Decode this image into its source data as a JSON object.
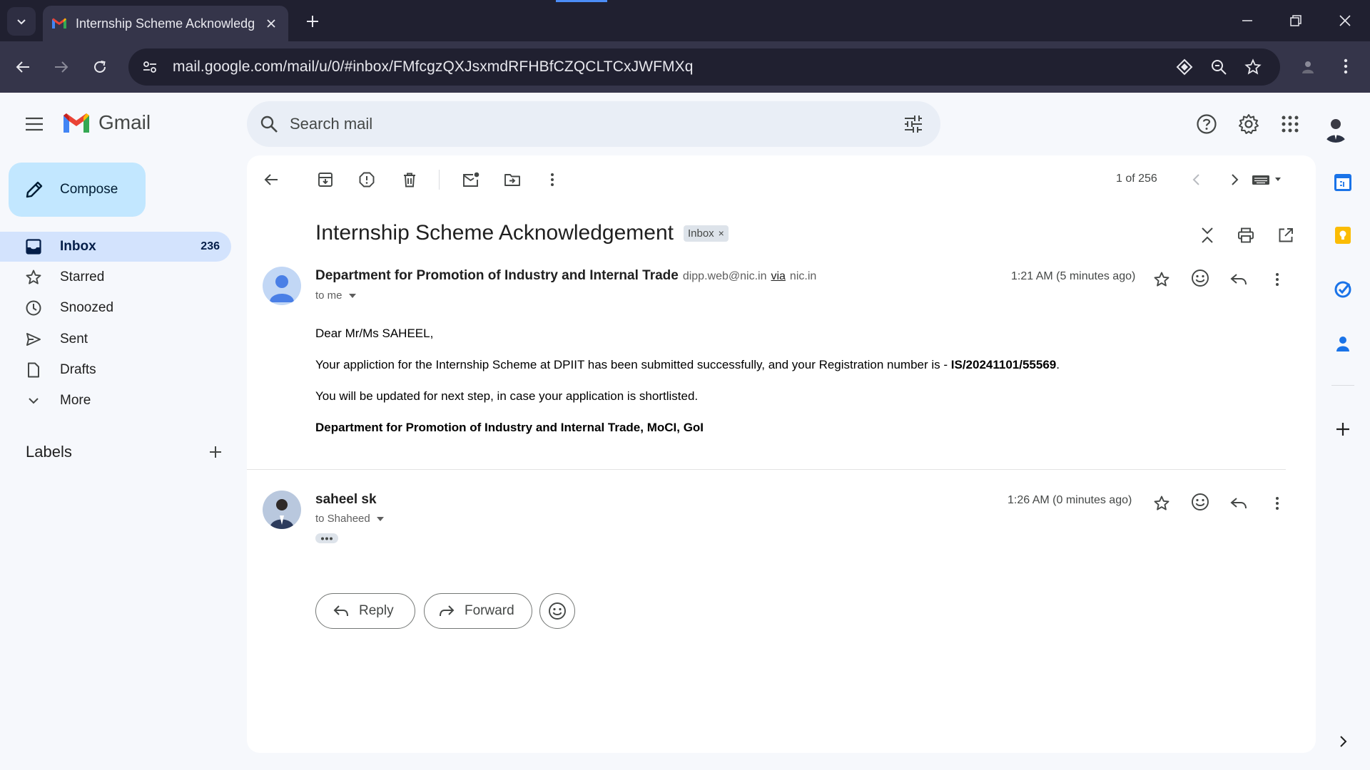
{
  "browser": {
    "tab_title": "Internship Scheme Acknowledg",
    "url": "mail.google.com/mail/u/0/#inbox/FMfcgzQXJsxmdRFHBfCZQCLTCxJWFMXq"
  },
  "gmail": {
    "logo_text": "Gmail",
    "search_placeholder": "Search mail",
    "compose_label": "Compose"
  },
  "nav": {
    "items": [
      {
        "label": "Inbox",
        "count": "236",
        "icon": "inbox-icon"
      },
      {
        "label": "Starred",
        "icon": "star-icon"
      },
      {
        "label": "Snoozed",
        "icon": "clock-icon"
      },
      {
        "label": "Sent",
        "icon": "send-icon"
      },
      {
        "label": "Drafts",
        "icon": "draft-icon"
      },
      {
        "label": "More",
        "icon": "chevron-down-icon"
      }
    ],
    "labels_title": "Labels"
  },
  "thread": {
    "pager": "1 of 256",
    "subject": "Internship Scheme Acknowledgement",
    "chip": "Inbox",
    "messages": [
      {
        "sender": "Department for Promotion of Industry and Internal Trade",
        "email": "dipp.web@nic.in",
        "via": "via",
        "via_domain": "nic.in",
        "to": "to me",
        "time": "1:21 AM (5 minutes ago)",
        "greeting": "Dear Mr/Ms SAHEEL,",
        "line1_prefix": "Your appliction for the Internship Scheme at DPIIT has been submitted successfully, and your Registration number is - ",
        "registration": "IS/20241101/55569",
        "line1_suffix": ".",
        "line2": "You will be updated for next step, in case your application is shortlisted.",
        "signature": "Department for Promotion of Industry and Internal Trade, MoCI, GoI"
      },
      {
        "sender": "saheel sk",
        "to": "to Shaheed",
        "time": "1:26 AM (0 minutes ago)"
      }
    ],
    "actions": {
      "reply": "Reply",
      "forward": "Forward"
    }
  },
  "colors": {
    "accent": "#0b57d0",
    "compose_bg": "#c2e7ff",
    "active_nav": "#d3e3fd",
    "chrome_dark": "#202030"
  }
}
